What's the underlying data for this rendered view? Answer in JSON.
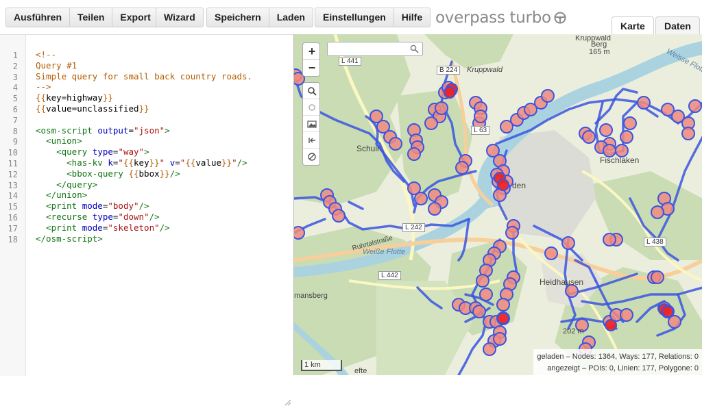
{
  "toolbar": {
    "run_label": "Ausführen",
    "share_label": "Teilen",
    "export_label": "Export",
    "wizard_label": "Wizard",
    "save_label": "Speichern",
    "load_label": "Laden",
    "settings_label": "Einstellungen",
    "help_label": "Hilfe",
    "app_title": "overpass turbo"
  },
  "tabs": {
    "map_label": "Karte",
    "data_label": "Daten"
  },
  "editor": {
    "line_numbers": [
      "1",
      "2",
      "3",
      "4",
      "5",
      "6",
      "7",
      "8",
      "9",
      "10",
      "11",
      "12",
      "13",
      "14",
      "15",
      "16",
      "17",
      "18"
    ],
    "lines": [
      [
        {
          "t": "<!--",
          "c": "comment"
        }
      ],
      [
        {
          "t": "Query #1",
          "c": "comment"
        }
      ],
      [
        {
          "t": "Simple query for small back country roads.",
          "c": "comment"
        }
      ],
      [
        {
          "t": "-->",
          "c": "comment"
        }
      ],
      [
        {
          "t": "{{",
          "c": "brace"
        },
        {
          "t": "key=highway",
          "c": "plain"
        },
        {
          "t": "}}",
          "c": "brace"
        }
      ],
      [
        {
          "t": "{{",
          "c": "brace"
        },
        {
          "t": "value=unclassified",
          "c": "plain"
        },
        {
          "t": "}}",
          "c": "brace"
        }
      ],
      [],
      [
        {
          "t": "<osm-script ",
          "c": "tag"
        },
        {
          "t": "output",
          "c": "attr"
        },
        {
          "t": "=",
          "c": "plain"
        },
        {
          "t": "\"json\"",
          "c": "str"
        },
        {
          "t": ">",
          "c": "tag"
        }
      ],
      [
        {
          "t": "  <union>",
          "c": "tag"
        }
      ],
      [
        {
          "t": "    <query ",
          "c": "tag"
        },
        {
          "t": "type",
          "c": "attr"
        },
        {
          "t": "=",
          "c": "plain"
        },
        {
          "t": "\"way\"",
          "c": "str"
        },
        {
          "t": ">",
          "c": "tag"
        }
      ],
      [
        {
          "t": "      <has-kv ",
          "c": "tag"
        },
        {
          "t": "k",
          "c": "attr"
        },
        {
          "t": "=",
          "c": "plain"
        },
        {
          "t": "\"",
          "c": "str"
        },
        {
          "t": "{{",
          "c": "brace"
        },
        {
          "t": "key",
          "c": "plain"
        },
        {
          "t": "}}",
          "c": "brace"
        },
        {
          "t": "\" ",
          "c": "str"
        },
        {
          "t": "v",
          "c": "attr"
        },
        {
          "t": "=",
          "c": "plain"
        },
        {
          "t": "\"",
          "c": "str"
        },
        {
          "t": "{{",
          "c": "brace"
        },
        {
          "t": "value",
          "c": "plain"
        },
        {
          "t": "}}",
          "c": "brace"
        },
        {
          "t": "\"",
          "c": "str"
        },
        {
          "t": "/>",
          "c": "tag"
        }
      ],
      [
        {
          "t": "      <bbox-query ",
          "c": "tag"
        },
        {
          "t": "{{",
          "c": "brace"
        },
        {
          "t": "bbox",
          "c": "plain"
        },
        {
          "t": "}}",
          "c": "brace"
        },
        {
          "t": "/>",
          "c": "tag"
        }
      ],
      [
        {
          "t": "    </query>",
          "c": "tag"
        }
      ],
      [
        {
          "t": "  </union>",
          "c": "tag"
        }
      ],
      [
        {
          "t": "  <print ",
          "c": "tag"
        },
        {
          "t": "mode",
          "c": "attr"
        },
        {
          "t": "=",
          "c": "plain"
        },
        {
          "t": "\"body\"",
          "c": "str"
        },
        {
          "t": "/>",
          "c": "tag"
        }
      ],
      [
        {
          "t": "  <recurse ",
          "c": "tag"
        },
        {
          "t": "type",
          "c": "attr"
        },
        {
          "t": "=",
          "c": "plain"
        },
        {
          "t": "\"down\"",
          "c": "str"
        },
        {
          "t": "/>",
          "c": "tag"
        }
      ],
      [
        {
          "t": "  <print ",
          "c": "tag"
        },
        {
          "t": "mode",
          "c": "attr"
        },
        {
          "t": "=",
          "c": "plain"
        },
        {
          "t": "\"skeleton\"",
          "c": "str"
        },
        {
          "t": "/>",
          "c": "tag"
        }
      ],
      [
        {
          "t": "</osm-script>",
          "c": "tag"
        }
      ]
    ]
  },
  "map": {
    "zoom_in_label": "+",
    "zoom_out_label": "−",
    "search_placeholder": "",
    "labels": {
      "krupwald_top": "Kruppwald",
      "berg": "Berg",
      "elev_165": "165 m",
      "krupwald": "Kruppwald",
      "weisse_flotte_top": "Weisse Flotte",
      "schuir": "Schuir",
      "fischlaken": "Fischlaken",
      "werden": "den",
      "heidhausen": "Heidhausen",
      "elev_202": "202 m",
      "weisse_flotte": "Weiße Flotte",
      "ruhrtalstrasse": "Ruhrtalstraße",
      "hamansberg": "mansberg",
      "bottom_text": "efte"
    },
    "road_signs": {
      "l441": "L 441",
      "b224": "B 224",
      "l63": "L 63",
      "l242": "L 242",
      "l438": "L 438",
      "l442": "L 442"
    },
    "scale_label": "1 km",
    "stats": {
      "loaded": "geladen – Nodes: 1364, Ways: 177, Relations: 0",
      "shown": "angezeigt – POIs: 0, Linien: 177, Polygone: 0"
    },
    "colors": {
      "route": "#3a55e0",
      "poi_fill": "#f08a80",
      "poi_hot": "#ee2222",
      "water": "#aad3df",
      "forest": "#c7dbb1"
    }
  }
}
